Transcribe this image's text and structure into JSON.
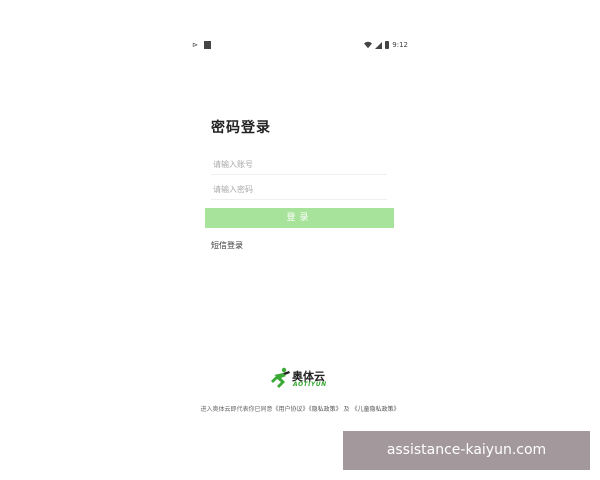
{
  "status_bar": {
    "left_icons": [
      "notification-icon",
      "sim-icon"
    ],
    "right_icons": [
      "wifi-icon",
      "signal-icon",
      "battery-icon"
    ],
    "time": "9:12"
  },
  "login": {
    "title": "密码登录",
    "account_placeholder": "请输入账号",
    "password_placeholder": "请输入密码",
    "login_button": "登录",
    "sms_login_link": "短信登录"
  },
  "logo": {
    "name_cn": "奥体云",
    "name_en": "AOTIYUN",
    "brand_color": "#3aa935"
  },
  "agreement": {
    "prefix": "进入奥体云即代表你已同意",
    "user_agreement": "《用户协议》",
    "privacy_policy": "《隐私政策》",
    "and": "及",
    "child_privacy_policy": "《儿童隐私政策》"
  },
  "watermark": {
    "text": "assistance-kaiyun.com"
  },
  "colors": {
    "button_bg": "#a8e39b",
    "button_text": "#ffffff",
    "watermark_bg": "#807076"
  }
}
